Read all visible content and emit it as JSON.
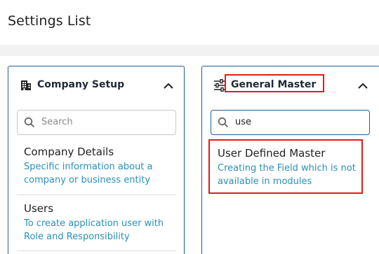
{
  "header": {
    "title": "Settings List"
  },
  "panels": [
    {
      "title": "Company Setup",
      "icon": "building-icon",
      "search": {
        "placeholder": "Search",
        "value": ""
      },
      "items": [
        {
          "title": "Company Details",
          "description": "Specific information about a company or business entity"
        },
        {
          "title": "Users",
          "description": "To create application user with Role and Responsibility"
        }
      ]
    },
    {
      "title": "General Master",
      "icon": "sliders-icon",
      "search": {
        "placeholder": "",
        "value": "use"
      },
      "items": [
        {
          "title": "User Defined Master",
          "description": "Creating the Field which is not available in modules"
        }
      ]
    }
  ],
  "colors": {
    "accent": "#1f5f9a",
    "link": "#2a8fb8",
    "highlight": "#e21b1b"
  }
}
